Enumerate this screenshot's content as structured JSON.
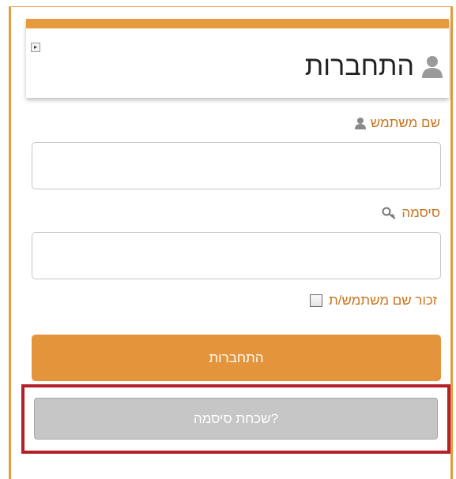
{
  "header": {
    "title": "התחברות",
    "collapse_icon": "chevron-right-icon",
    "user_icon": "user-icon"
  },
  "form": {
    "username_label": "שם משתמש",
    "username_value": "",
    "password_label": "סיסמה",
    "password_value": "",
    "remember_label": "זכור שם משתמש/ת",
    "remember_checked": false,
    "login_button": "התחברות",
    "forgot_button": "שכחת סיסמה?"
  },
  "colors": {
    "accent": "#e69a3c",
    "label": "#c9741e",
    "highlight_border": "#b3202a",
    "disabled_button": "#c6c6c6"
  }
}
